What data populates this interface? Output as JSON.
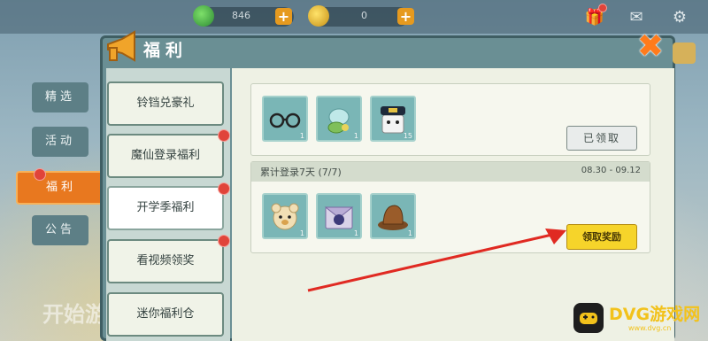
{
  "topbar": {
    "currency1": {
      "icon": "green-gem-icon",
      "value": "846"
    },
    "currency2": {
      "icon": "gold-coin-icon",
      "value": "0"
    },
    "icons": [
      "gift-icon",
      "mail-icon",
      "gear-icon"
    ]
  },
  "side_tabs": [
    {
      "label": "精选"
    },
    {
      "label": "活动"
    },
    {
      "label": "福利"
    },
    {
      "label": "公告"
    }
  ],
  "background": {
    "start_text": "开始游"
  },
  "panel": {
    "title": "福利"
  },
  "menu": [
    {
      "label": "铃铛兑豪礼"
    },
    {
      "label": "魔仙登录福利"
    },
    {
      "label": "开学季福利"
    },
    {
      "label": "看视频领奖"
    },
    {
      "label": "迷你福利仓"
    }
  ],
  "card1": {
    "items": [
      {
        "icon": "glasses-icon",
        "count": "1"
      },
      {
        "icon": "pet-creature-icon",
        "count": "1"
      },
      {
        "icon": "captain-cat-icon",
        "count": "15"
      }
    ],
    "button": "已领取"
  },
  "card2": {
    "title": "累计登录7天 (7/7)",
    "date": "08.30 - 09.12",
    "items": [
      {
        "icon": "bear-avatar-icon",
        "count": "1"
      },
      {
        "icon": "character-envelope-icon",
        "count": "1"
      },
      {
        "icon": "brown-hat-icon",
        "count": "1"
      }
    ],
    "button": "领取奖励"
  },
  "watermark": {
    "text": "DVG游戏网",
    "sub": "www.dvg.cn"
  },
  "colors": {
    "accent": "#e8781f",
    "claim": "#f6d42a",
    "arrow": "#e02a22",
    "panel": "#6a8f94"
  }
}
